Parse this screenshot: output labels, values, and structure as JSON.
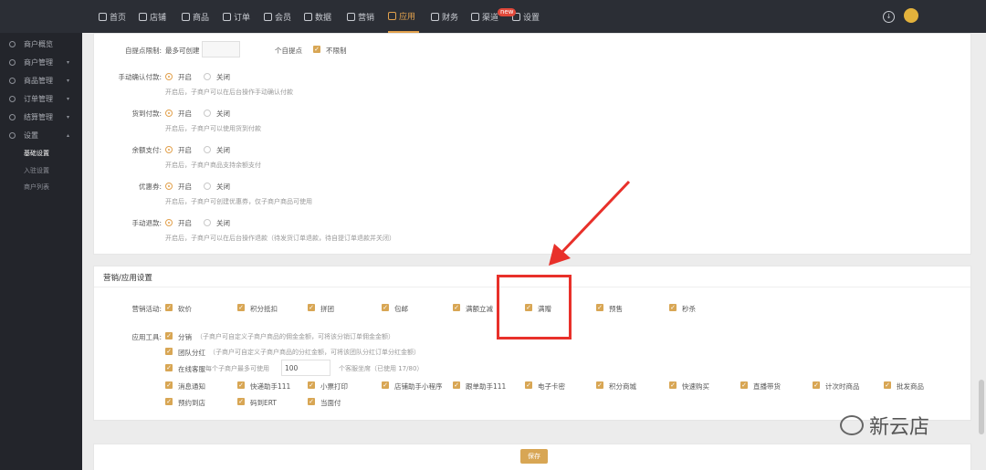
{
  "nav": {
    "items": [
      {
        "label": "首页",
        "icon": "home-icon"
      },
      {
        "label": "店铺",
        "icon": "store-icon"
      },
      {
        "label": "商品",
        "icon": "goods-icon"
      },
      {
        "label": "订单",
        "icon": "order-icon"
      },
      {
        "label": "会员",
        "icon": "member-icon"
      },
      {
        "label": "数据",
        "icon": "data-icon"
      },
      {
        "label": "营销",
        "icon": "tag-icon"
      },
      {
        "label": "应用",
        "icon": "app-icon"
      },
      {
        "label": "财务",
        "icon": "finance-icon"
      },
      {
        "label": "渠道",
        "icon": "channel-icon"
      },
      {
        "label": "设置",
        "icon": "settings-icon"
      }
    ],
    "active": "应用",
    "new_badge": "new"
  },
  "sidebar": {
    "items": [
      {
        "label": "商户概览",
        "caret": ""
      },
      {
        "label": "商户管理",
        "caret": "▾"
      },
      {
        "label": "商品管理",
        "caret": "▾"
      },
      {
        "label": "订单管理",
        "caret": "▾"
      },
      {
        "label": "结算管理",
        "caret": "▾"
      },
      {
        "label": "设置",
        "caret": "▴"
      }
    ],
    "subitems": [
      "基础设置",
      "入驻设置",
      "商户列表"
    ],
    "active_sub": "基础设置"
  },
  "settings": {
    "pickup": {
      "label": "自提点限制:",
      "prefix": "最多可创建",
      "suffix": "个自提点",
      "unlimited": "不限制"
    },
    "manual_confirm": {
      "label": "手动确认付款:",
      "on": "开启",
      "off": "关闭",
      "hint": "开启后，子商户可以在后台操作手动确认付款"
    },
    "installment": {
      "label": "货到付款:",
      "on": "开启",
      "off": "关闭",
      "hint": "开启后，子商户可以使用货到付款"
    },
    "balance_pay": {
      "label": "余额支付:",
      "on": "开启",
      "off": "关闭",
      "hint": "开启后，子商户商品支持余额支付"
    },
    "coupon": {
      "label": "优惠券:",
      "on": "开启",
      "off": "关闭",
      "hint": "开启后，子商户可创建优惠券，仅子商户商品可使用"
    },
    "manual_refund": {
      "label": "手动退款:",
      "on": "开启",
      "off": "关闭",
      "hint": "开启后，子商户可以在后台操作退款（待发货订单退款，待自提订单退款并关闭）"
    }
  },
  "marketing": {
    "title": "营销/应用设置",
    "activity_label": "营销活动:",
    "activities": [
      "砍价",
      "积分抵扣",
      "拼团",
      "包邮",
      "满额立减",
      "满赠",
      "预售",
      "秒杀"
    ],
    "tools_label": "应用工具:",
    "tool_distribution": {
      "label": "分销",
      "hint": "（子商户可自定义子商户商品的佣金金额，可将该分销订单佣金金额）"
    },
    "tool_team": {
      "label": "团队分红",
      "hint": "（子商户可自定义子商户商品的分红金额，可将该团队分红订单分红金额）"
    },
    "tool_service": {
      "label": "在线客服",
      "prefix": "每个子商户最多可使用",
      "value": "100",
      "suffix": "个客服坐席（已使用 17/80）"
    },
    "tools_row1": [
      "消息通知",
      "快递助手111",
      "小票打印",
      "店铺助手小程序",
      "跟单助手111",
      "电子卡密",
      "积分商城",
      "快速购买",
      "直播带货",
      "计次时商品",
      "批发商品"
    ],
    "tools_row2": [
      "预约到店",
      "码到ERT",
      "当面付"
    ]
  },
  "actions": {
    "save": "保存"
  },
  "watermark": "新云店"
}
